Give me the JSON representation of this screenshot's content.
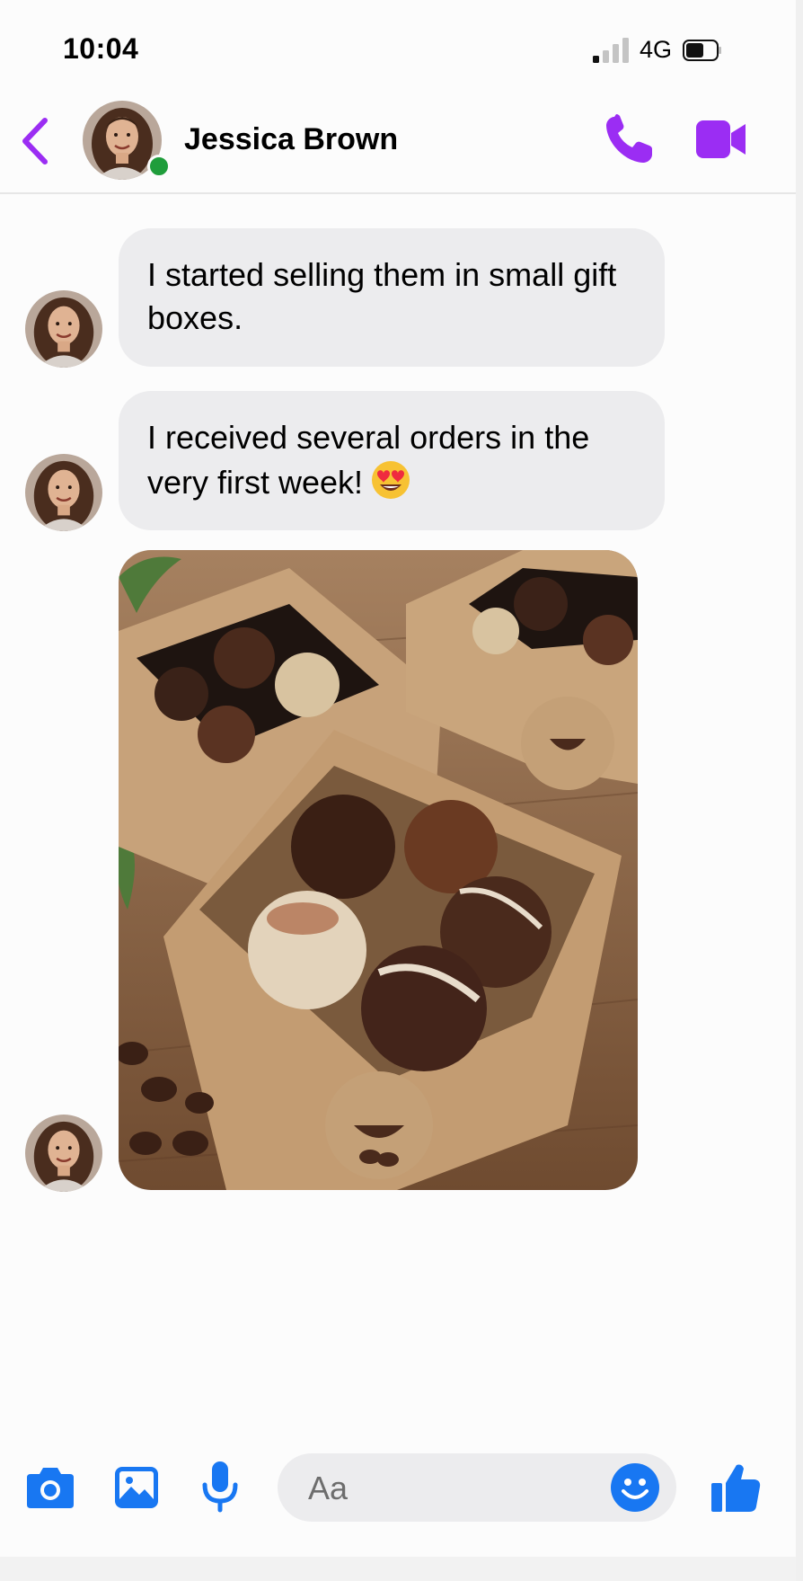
{
  "status_bar": {
    "time": "10:04",
    "network": "4G"
  },
  "header": {
    "contact_name": "Jessica Brown",
    "online": true
  },
  "messages": [
    {
      "sender": "Jessica Brown",
      "text": "I started selling them in small gift boxes."
    },
    {
      "sender": "Jessica Brown",
      "text": "I received several orders in the very first week!",
      "emoji": "heart-eyes"
    },
    {
      "sender": "Jessica Brown",
      "type": "image",
      "description_icon": "chocolate-gift-box-photo"
    }
  ],
  "composer": {
    "placeholder": "Aa"
  },
  "colors": {
    "accent_purple": "#9b2df3",
    "accent_blue": "#1877f2",
    "bubble": "#ececee",
    "online": "#1f9d3b"
  },
  "icons": [
    "back-chevron-icon",
    "phone-icon",
    "video-camera-icon",
    "camera-icon",
    "gallery-icon",
    "microphone-icon",
    "smiley-icon",
    "thumbs-up-icon"
  ]
}
